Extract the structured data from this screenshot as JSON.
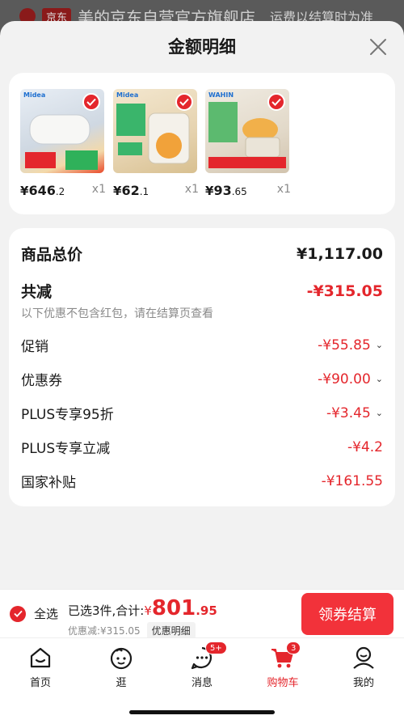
{
  "background": {
    "badge": "京东",
    "shop_name": "美的京东自营官方旗舰店",
    "right_text": "运费以结算时为准"
  },
  "sheet": {
    "title": "金额明细"
  },
  "products": [
    {
      "price_int": "646",
      "price_dec": ".2",
      "qty": "x1",
      "brand": "Midea",
      "color": "#dfe6ee"
    },
    {
      "price_int": "62",
      "price_dec": ".1",
      "qty": "x1",
      "brand": "Midea",
      "color": "#e9ddc6"
    },
    {
      "price_int": "93",
      "price_dec": ".65",
      "qty": "x1",
      "brand": "WAHIN",
      "color": "#ece6dc"
    }
  ],
  "yen": "¥",
  "breakdown": {
    "total_label": "商品总价",
    "total_value": "¥1,117.00",
    "reduce_label": "共减",
    "reduce_value": "-¥315.05",
    "note": "以下优惠不包含红包，请在结算页查看",
    "items": [
      {
        "label": "促销",
        "value": "-¥55.85"
      },
      {
        "label": "优惠券",
        "value": "-¥90.00"
      },
      {
        "label": "PLUS专享95折",
        "value": "-¥3.45"
      },
      {
        "label": "PLUS专享立减",
        "value": "-¥4.2"
      },
      {
        "label": "国家补贴",
        "value": "-¥161.55"
      }
    ]
  },
  "checkout": {
    "select_all": "全选",
    "selected_text": "已选3件,合计:",
    "total_int": "801",
    "total_dec": ".95",
    "discount_text": "优惠减:¥315.05",
    "detail_link": "优惠明细",
    "button": "领券结算"
  },
  "tabs": [
    {
      "label": "首页",
      "icon": "home-icon"
    },
    {
      "label": "逛",
      "icon": "browse-face-icon"
    },
    {
      "label": "消息",
      "icon": "message-icon",
      "badge": "5+"
    },
    {
      "label": "购物车",
      "icon": "cart-icon",
      "badge": "3",
      "active": true
    },
    {
      "label": "我的",
      "icon": "profile-icon"
    }
  ],
  "colors": {
    "accent": "#e4262c",
    "button": "#f2323a"
  }
}
